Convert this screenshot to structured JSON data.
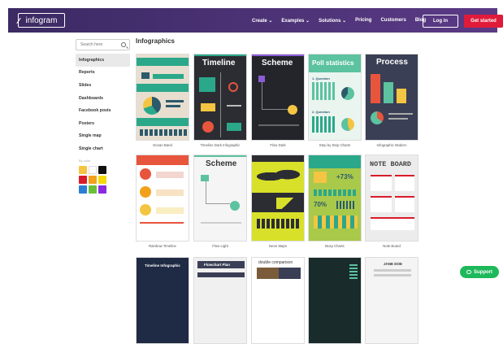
{
  "nav": {
    "logo": "infogram",
    "menu": [
      "Create ⌄",
      "Examples ⌄",
      "Solutions ⌄",
      "Pricing",
      "Customers",
      "Blog"
    ],
    "login": "Log in",
    "get_started": "Get started"
  },
  "search": {
    "placeholder": "Search here"
  },
  "sidebar": {
    "items": [
      "Infographics",
      "Reports",
      "Slides",
      "Dashboards",
      "Facebook posts",
      "Posters",
      "Single map",
      "Single chart"
    ],
    "active": "Infographics",
    "colors_label": "By color",
    "colors": [
      "#f4c542",
      "#ffffff",
      "#111111",
      "#d81b2a",
      "#f2a11b",
      "#f5d90a",
      "#2a7fd4",
      "#6bbf3a",
      "#8a2be2"
    ]
  },
  "main": {
    "title": "Infographics",
    "cards": [
      {
        "caption": "Ocean Band",
        "thumb_title": ""
      },
      {
        "caption": "Timeline Dark Infographic",
        "thumb_title": "Timeline"
      },
      {
        "caption": "Flow Dark",
        "thumb_title": "Scheme"
      },
      {
        "caption": "Step by Step Charts",
        "thumb_title": "Poll statistics"
      },
      {
        "caption": "Infographic Modern",
        "thumb_title": "Process"
      },
      {
        "caption": "Rainbow Timeline",
        "thumb_title": ""
      },
      {
        "caption": "Flow Light",
        "thumb_title": "Scheme"
      },
      {
        "caption": "Neon Maps",
        "thumb_title": ""
      },
      {
        "caption": "Busy Charts",
        "thumb_title": "+73%"
      },
      {
        "caption": "Note Board",
        "thumb_title": "NOTE BOARD"
      },
      {
        "caption": "",
        "thumb_title": "Timeline Infographic"
      },
      {
        "caption": "",
        "thumb_title": "Flowchart Plan"
      },
      {
        "caption": "",
        "thumb_title": "double comparison"
      },
      {
        "caption": "",
        "thumb_title": ""
      },
      {
        "caption": "",
        "thumb_title": "JANE DOE"
      }
    ],
    "poll_labels": [
      "1. Question",
      "2. Question"
    ],
    "busy_pct": "70%"
  },
  "support": {
    "label": "Support"
  }
}
